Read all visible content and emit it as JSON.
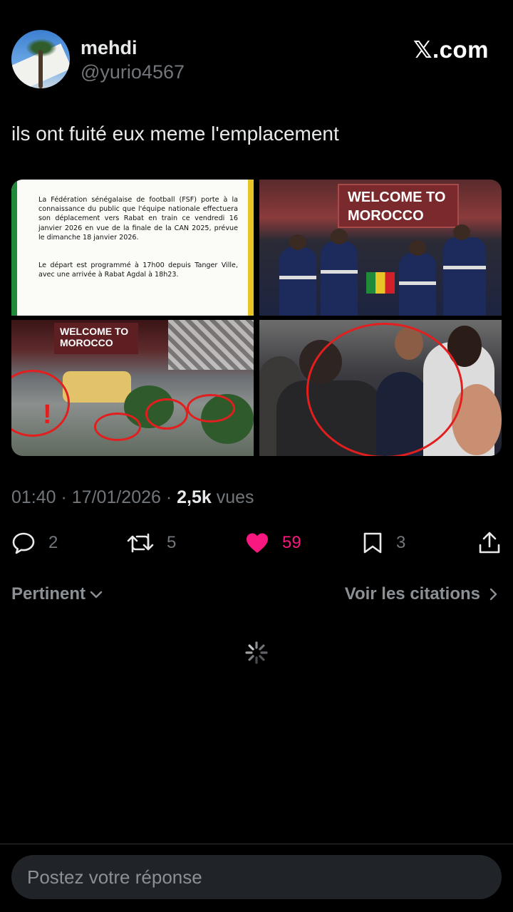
{
  "user": {
    "name": "mehdi",
    "handle": "@yurio4567",
    "avatar_icon": "palm-tree-avatar"
  },
  "brand": "𝕏.com",
  "tweet": {
    "text": "ils ont fuité eux meme l'emplacement",
    "media": {
      "doc": {
        "paragraph1": "La Fédération sénégalaise de football (FSF) porte à la connaissance du public que l'équipe nationale effectuera son déplacement vers Rabat en train ce vendredi 16 janvier 2026 en vue de la finale de la CAN 2025, prévue le dimanche 18 janvier 2026.",
        "paragraph2": "Le départ est programmé à 17h00 depuis Tanger Ville, avec une arrivée à Rabat Agdal à 18h23."
      },
      "banner1": "WELCOME TO MOROCCO",
      "banner2": "WELCOME TO MOROCCO",
      "exclamation": "!"
    }
  },
  "meta": {
    "time": "01:40",
    "sep1": " · ",
    "date": "17/01/2026",
    "sep2": " · ",
    "views_count": "2,5k",
    "views_label": " vues"
  },
  "actions": {
    "replies": "2",
    "retweets": "5",
    "likes": "59",
    "bookmarks": "3",
    "like_color": "#f91880"
  },
  "filters": {
    "sort_label": "Pertinent",
    "quotes_label": "Voir les citations"
  },
  "reply": {
    "placeholder": "Postez votre réponse"
  }
}
